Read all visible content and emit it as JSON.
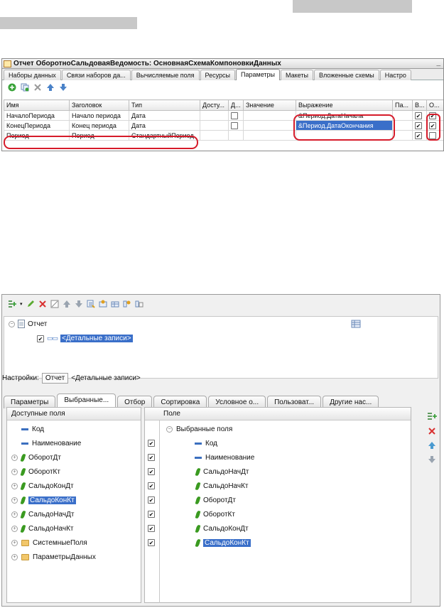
{
  "top_window": {
    "title": "Отчет ОборотноСальдоваяВедомость: ОсновнаяСхемаКомпоновкиДанных",
    "minimize": "_",
    "tabs": [
      "Наборы данных",
      "Связи наборов да...",
      "Вычисляемые поля",
      "Ресурсы",
      "Параметры",
      "Макеты",
      "Вложенные схемы",
      "Настро"
    ],
    "active_tab": "Параметры",
    "columns": [
      "Имя",
      "Заголовок",
      "Тип",
      "Досту...",
      "Д...",
      "Значение",
      "Выражение",
      "Па...",
      "В...",
      "О..."
    ],
    "rows": [
      {
        "name": "НачалоПериода",
        "title": "Начало периода",
        "type": "Дата",
        "expr": "&Период.ДатаНачала",
        "d": false,
        "v": true,
        "o": true
      },
      {
        "name": "КонецПериода",
        "title": "Конец периода",
        "type": "Дата",
        "expr": "&Период.ДатаОкончания",
        "d": false,
        "v": true,
        "o": true
      },
      {
        "name": "Период",
        "title": "Период",
        "type": "СтандартныйПериод",
        "expr": "",
        "v": true,
        "o": false
      }
    ]
  },
  "bottom_window": {
    "tree": {
      "root": "Отчет",
      "child": "<Детальные записи>"
    },
    "settings_label": "Настройки:",
    "settings_path_root": "Отчет",
    "settings_path_child": "<Детальные записи>",
    "tabs": [
      "Параметры",
      "Выбранные...",
      "Отбор",
      "Сортировка",
      "Условное о...",
      "Пользоват...",
      "Другие нас..."
    ],
    "active_tab": "Выбранные...",
    "available": {
      "header": "Доступные поля",
      "items": [
        {
          "label": "Код",
          "icon": "field-dash-icon",
          "expandable": false
        },
        {
          "label": "Наименование",
          "icon": "field-dash-icon",
          "expandable": false
        },
        {
          "label": "ОборотДт",
          "icon": "resource-leaf-icon",
          "expandable": true
        },
        {
          "label": "ОборотКт",
          "icon": "resource-leaf-icon",
          "expandable": true
        },
        {
          "label": "СальдоКонДт",
          "icon": "resource-leaf-icon",
          "expandable": true
        },
        {
          "label": "СальдоКонКт",
          "icon": "resource-leaf-icon",
          "expandable": true,
          "selected": true
        },
        {
          "label": "СальдоНачДт",
          "icon": "resource-leaf-icon",
          "expandable": true
        },
        {
          "label": "СальдоНачКт",
          "icon": "resource-leaf-icon",
          "expandable": true
        },
        {
          "label": "СистемныеПоля",
          "icon": "folder-icon",
          "expandable": true
        },
        {
          "label": "ПараметрыДанных",
          "icon": "folder-icon",
          "expandable": true
        }
      ]
    },
    "selected": {
      "header": "Поле",
      "group": "Выбранные поля",
      "items": [
        {
          "label": "Код",
          "icon": "field-dash-icon"
        },
        {
          "label": "Наименование",
          "icon": "field-dash-icon"
        },
        {
          "label": "СальдоНачДт",
          "icon": "resource-leaf-icon"
        },
        {
          "label": "СальдоНачКт",
          "icon": "resource-leaf-icon"
        },
        {
          "label": "ОборотДт",
          "icon": "resource-leaf-icon"
        },
        {
          "label": "ОборотКт",
          "icon": "resource-leaf-icon"
        },
        {
          "label": "СальдоКонДт",
          "icon": "resource-leaf-icon"
        },
        {
          "label": "СальдоКонКт",
          "icon": "resource-leaf-icon",
          "selected": true
        }
      ]
    }
  },
  "colors": {
    "selection": "#3a6fc9",
    "highlight_oval": "#d61b2a"
  }
}
